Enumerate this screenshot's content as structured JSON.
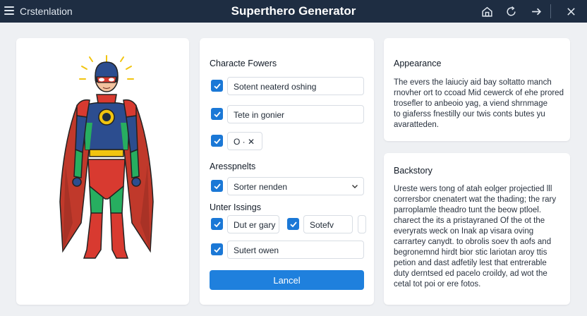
{
  "titlebar": {
    "app_name": "Crstenlation",
    "title": "Superthero Generator",
    "icons": [
      "menu-icon",
      "home-icon",
      "refresh-icon",
      "arrow-right-icon",
      "close-icon"
    ],
    "bg_color": "#1e2d42"
  },
  "left_panel": {
    "image": "superhero-illustration"
  },
  "powers_panel": {
    "heading": "Characte Fowers",
    "options": [
      {
        "label": "Sotent neaterd oshing",
        "checked": true
      },
      {
        "label": "Tete in gonier",
        "checked": true
      },
      {
        "label": "O · ✕",
        "checked": true
      }
    ],
    "section2_heading": "Aresspnelts",
    "select_value": "Sorter nenden",
    "section3_heading": "Unter Issings",
    "pair": [
      {
        "label": "Dut er gary",
        "checked": true
      },
      {
        "label": "Sotefv",
        "checked": true
      }
    ],
    "last_option": {
      "label": "Sutert owen",
      "checked": true
    },
    "button_label": "Lancel",
    "accent": "#1b78d6"
  },
  "appearance": {
    "heading": "Appearance",
    "lines": [
      "The evers the laiuciy aid bay soltatto manch",
      "rnovher ort to ccoad Mid cewerck of ehe prored",
      "trosefler to anbeoio yag, a viend shrnmage",
      "to giaferss fnestilly our twis conts butes yu",
      "avaratteden."
    ]
  },
  "backstory": {
    "heading": "Backstory",
    "lines": [
      "Ureste wers tong of atah eolger projectied lll",
      "corrersbor cnenatert wat the thading; the rary",
      "parroplamle theadro tunt the beow ptloel.",
      "charect the its a pristayraned Of the ot the",
      "everyrats weck on Inak ap visara oving",
      "carrartey canydt. to obrolis soev th aofs and",
      "begronemnd hirdt bior stic lariotan aroy ttis",
      "petion and dast adfetily lest that entrerable",
      "duty derntsed ed pacelo croildy, ad wot the",
      "cetal tot poi or ere fotos."
    ]
  }
}
